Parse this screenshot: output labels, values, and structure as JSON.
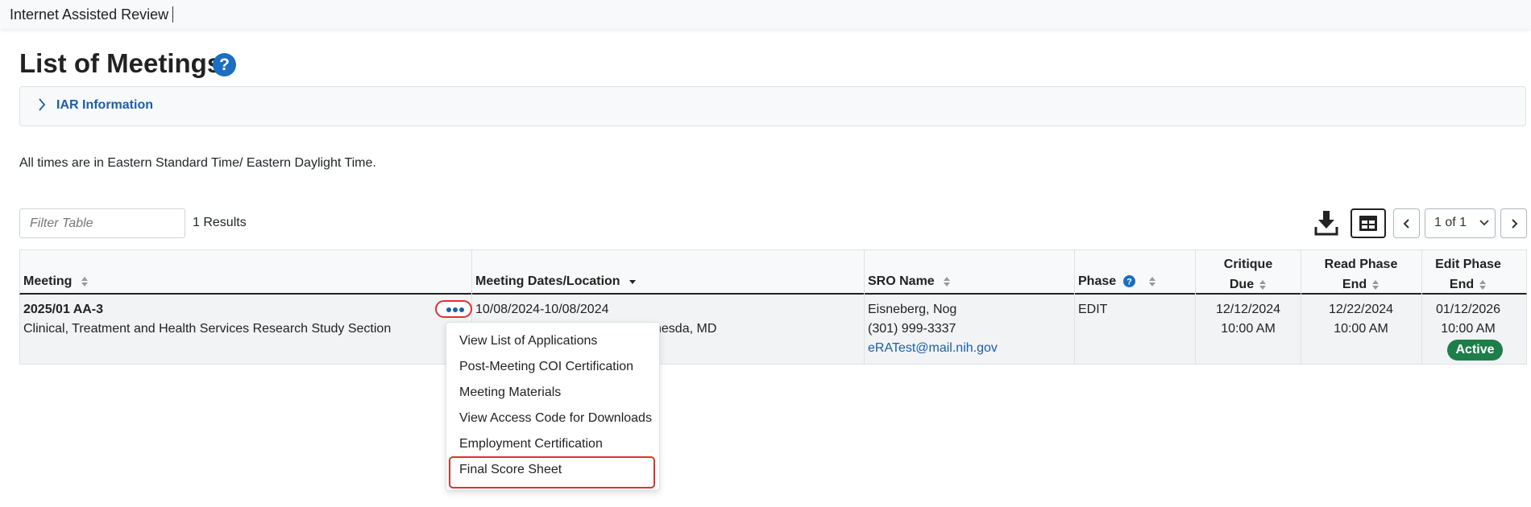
{
  "app": {
    "title": "Internet Assisted Review"
  },
  "page": {
    "title": "List of Meetings",
    "help_icon": "question-circle-icon"
  },
  "iar_panel": {
    "label": "IAR Information",
    "icon": "chevron-right-icon"
  },
  "timezone_note": "All times are in Eastern Standard Time/ Eastern Daylight Time.",
  "toolbar": {
    "filter_placeholder": "Filter Table",
    "results_text": "1 Results",
    "download_icon": "download-icon",
    "columns_icon": "table-columns-icon",
    "page_indicator": "1 of 1"
  },
  "table": {
    "headers": {
      "meeting": "Meeting",
      "dates": "Meeting Dates/Location",
      "sro": "SRO Name",
      "phase": "Phase",
      "critique_due": [
        "Critique",
        "Due"
      ],
      "read_phase_end": [
        "Read Phase",
        "End"
      ],
      "edit_phase_end": [
        "Edit Phase",
        "End"
      ]
    },
    "row": {
      "meeting_id": "2025/01 AA-3",
      "meeting_name": "Clinical, Treatment and Health Services Research Study Section",
      "dates": "10/08/2024-10/08/2024",
      "location_visible": "hesda, MD",
      "sro_name": "Eisneberg, Nog",
      "sro_phone": "(301) 999-3337",
      "sro_email": "eRATest@mail.nih.gov",
      "phase": "EDIT",
      "critique_due": [
        "12/12/2024",
        "10:00 AM"
      ],
      "read_phase_end": [
        "12/22/2024",
        "10:00 AM"
      ],
      "edit_phase_end": [
        "01/12/2026",
        "10:00 AM"
      ],
      "status": "Active"
    }
  },
  "actions_menu": {
    "items": [
      "View List of Applications",
      "Post-Meeting COI Certification",
      "Meeting Materials",
      "View Access Code for Downloads",
      "Employment Certification",
      "Final Score Sheet"
    ]
  },
  "colors": {
    "link": "#1b5fa6",
    "badge_active": "#1e7e4a",
    "highlight": "#e03131"
  }
}
